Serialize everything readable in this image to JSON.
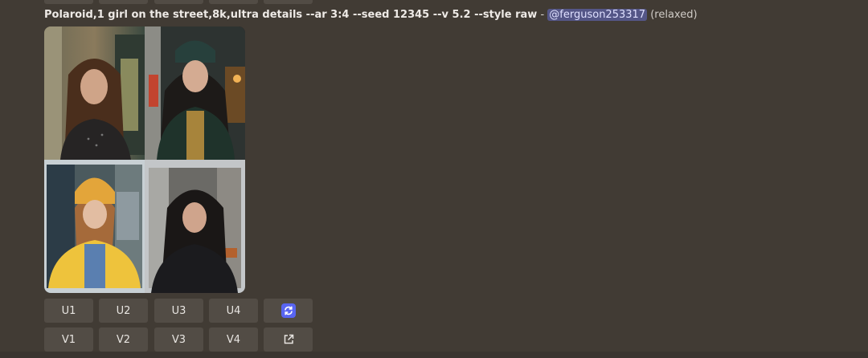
{
  "message": {
    "prompt": "Polaroid,1 girl on the street,8k,ultra details --ar 3:4 --seed 12345 --v 5.2 --style raw",
    "separator": " - ",
    "mention": "@ferguson253317",
    "status": "(relaxed)"
  },
  "image_grid": {
    "tiles": [
      "girl-long-brown-hair-storefront",
      "girl-dark-beanie-dark-jacket",
      "girl-yellow-beanie-yellow-jacket",
      "girl-dark-jacket-city-street"
    ]
  },
  "upscale_row": {
    "buttons": [
      "U1",
      "U2",
      "U3",
      "U4"
    ],
    "icon": "refresh-icon"
  },
  "variation_row": {
    "buttons": [
      "V1",
      "V2",
      "V3",
      "V4"
    ],
    "icon": "open-external-icon"
  },
  "colors": {
    "background": "#413b34",
    "button": "#524c45",
    "mention_bg": "#545687",
    "accent_blue": "#5865f2"
  }
}
